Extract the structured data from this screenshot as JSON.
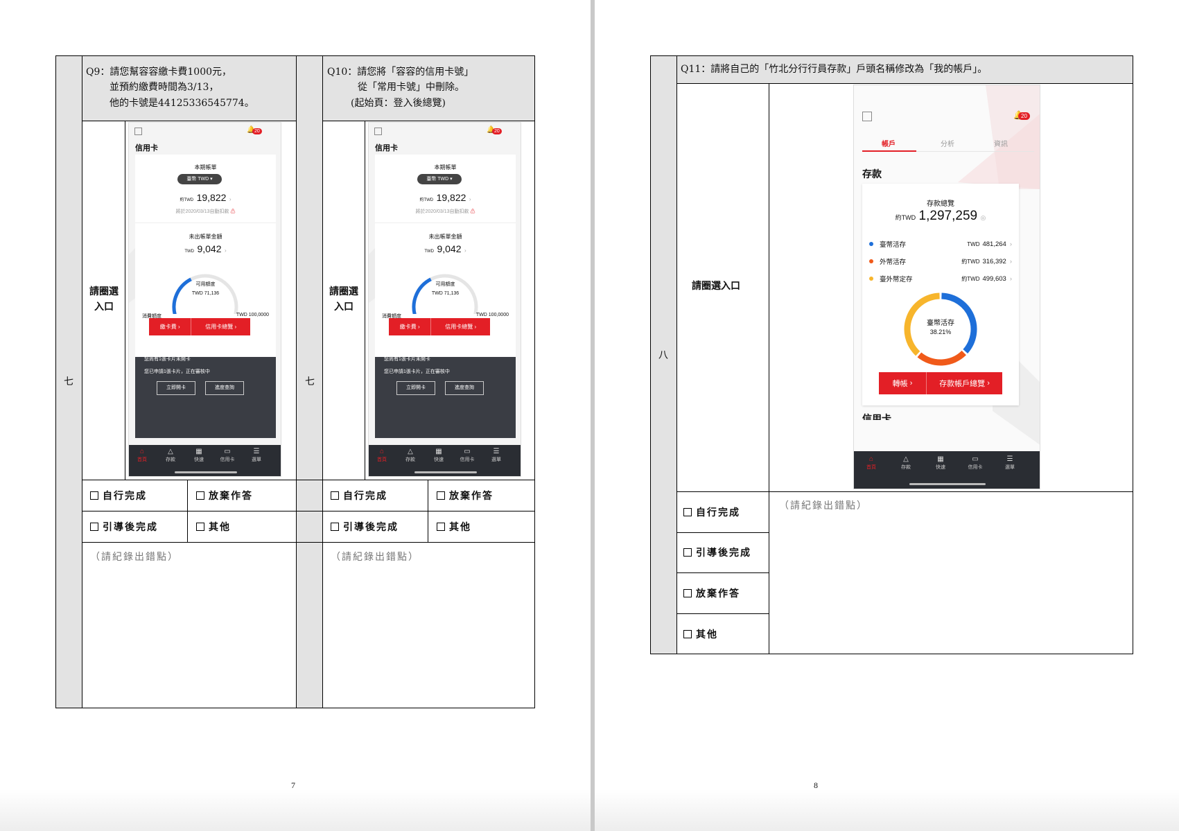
{
  "left_page": {
    "page_number": "7",
    "columns": [
      {
        "section": "七",
        "question_lines": [
          "Q9：請您幫容容繳卡費1000元，",
          "並預約繳費時間為3/13，",
          "他的卡號是44125336545774。"
        ],
        "entry_label_lines": [
          "請圈選",
          "入口"
        ],
        "options": {
          "self_done": "自行完成",
          "give_up": "放棄作答",
          "guided_done": "引導後完成",
          "other": "其他"
        },
        "note": "（請紀錄出錯點）"
      },
      {
        "section": "七",
        "question_lines": [
          "Q10：請您將「容容的信用卡號」",
          "從「常用卡號」中刪除。",
          "(起始頁：登入後總覽)"
        ],
        "entry_label_lines": [
          "請圈選",
          "入口"
        ],
        "options": {
          "self_done": "自行完成",
          "give_up": "放棄作答",
          "guided_done": "引導後完成",
          "other": "其他"
        },
        "note": "（請紀錄出錯點）"
      }
    ],
    "credit_screen": {
      "badge": "20",
      "title": "信用卡",
      "bill_label": "本期帳單",
      "currency_selector": "臺幣 TWD",
      "approx_prefix": "約TWD",
      "bill_amount": "19,822",
      "autopay_note": "將於2020/03/13自動扣款",
      "unbilled_label": "未出帳單金額",
      "unbilled_prefix": "TWD",
      "unbilled_amount": "9,042",
      "available_label": "可用額度",
      "available_amount": "TWD 71,136",
      "available_fraction": 0.7114,
      "limit_label": "消費額度",
      "limit_value": "TWD 100,0000",
      "pay_button": "繳卡費",
      "overview_button": "信用卡總覽",
      "unopened_note": "您尚有1張卡片未開卡",
      "applying_note": "您已申請1張卡片，正在審核中",
      "activate_button": "立即開卡",
      "progress_button": "進度查詢",
      "tabs": [
        "首頁",
        "存款",
        "快速",
        "信用卡",
        "選單"
      ]
    }
  },
  "right_page": {
    "page_number": "8",
    "section": "八",
    "question": "Q11：請將自己的「竹北分行行員存款」戶頭名稱修改為「我的帳戶」。",
    "entry_label": "請圈選入口",
    "options": {
      "self_done": "自行完成",
      "guided_done": "引導後完成",
      "give_up": "放棄作答",
      "other": "其他"
    },
    "note": "（請紀錄出錯點）",
    "deposit_screen": {
      "badge": "20",
      "top_tabs": [
        "帳戶",
        "分析",
        "資訊"
      ],
      "section_title": "存款",
      "overview_label": "存款總覽",
      "total_prefix": "約TWD",
      "total_amount": "1,297,259",
      "items": [
        {
          "name": "臺幣活存",
          "prefix": "TWD",
          "amount": "481,264",
          "color": "#1e6fd9"
        },
        {
          "name": "外幣活存",
          "prefix": "約TWD",
          "amount": "316,392",
          "color": "#f05a1a"
        },
        {
          "name": "臺外幣定存",
          "prefix": "約TWD",
          "amount": "499,603",
          "color": "#f7b52c"
        }
      ],
      "donut_label": "臺幣活存",
      "donut_percent": "38.21%",
      "transfer_button": "轉帳",
      "overview_button": "存款帳戶總覽",
      "next_section": "信用卡",
      "tabs": [
        "首頁",
        "存款",
        "快速",
        "信用卡",
        "選單"
      ]
    }
  },
  "colors": {
    "brand_red": "#e31f26",
    "dark_panel": "#3a3d44",
    "cell_gray": "#e3e3e3"
  }
}
